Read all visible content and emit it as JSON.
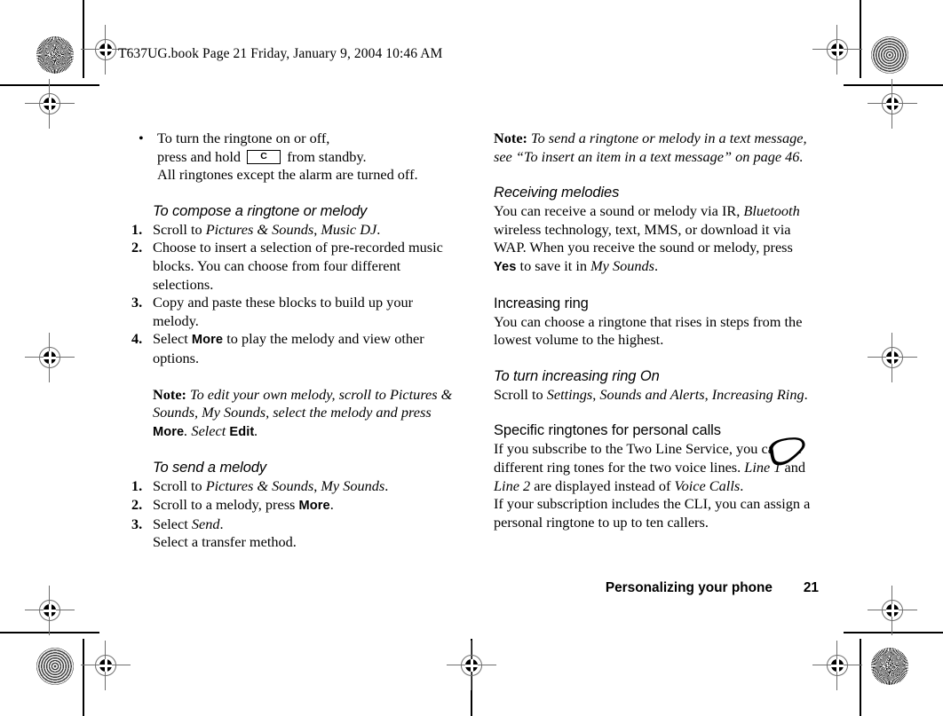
{
  "document": {
    "header_line": "T637UG.book  Page 21  Friday, January 9, 2004  10:46 AM",
    "page_number": "21",
    "footer_title": "Personalizing your phone"
  },
  "left_column": {
    "bullet": {
      "marker": "•",
      "line1": "To turn the ringtone on or off,",
      "line2_before": "press and hold",
      "keycap_label": "C",
      "line2_after": "from standby.",
      "line3": "All ringtones except the alarm are turned off."
    },
    "compose_section": {
      "heading": "To compose a ringtone or melody",
      "steps": [
        {
          "num": "1.",
          "parts": [
            {
              "text": "Scroll to ",
              "style": "plain"
            },
            {
              "text": "Pictures & Sounds",
              "style": "italic"
            },
            {
              "text": ", ",
              "style": "plain"
            },
            {
              "text": "Music DJ",
              "style": "italic"
            },
            {
              "text": ".",
              "style": "plain"
            }
          ]
        },
        {
          "num": "2.",
          "parts": [
            {
              "text": "Choose to insert a selection of pre-recorded music blocks. You can choose from four different selections.",
              "style": "plain"
            }
          ]
        },
        {
          "num": "3.",
          "parts": [
            {
              "text": "Copy and paste these blocks to build up your melody.",
              "style": "plain"
            }
          ]
        },
        {
          "num": "4.",
          "parts": [
            {
              "text": "Select ",
              "style": "plain"
            },
            {
              "text": "More",
              "style": "ui"
            },
            {
              "text": " to play the melody and view other options.",
              "style": "plain"
            }
          ]
        }
      ]
    },
    "note": {
      "label": "Note:",
      "parts": [
        {
          "text": " To edit your own melody, scroll to Pictures & Sounds, My Sounds, select the melody and press ",
          "style": "italic"
        },
        {
          "text": "More",
          "style": "ui"
        },
        {
          "text": ". Select ",
          "style": "italic"
        },
        {
          "text": "Edit",
          "style": "ui"
        },
        {
          "text": ".",
          "style": "italic"
        }
      ]
    },
    "send_section": {
      "heading": "To send a melody",
      "steps": [
        {
          "num": "1.",
          "parts": [
            {
              "text": "Scroll to ",
              "style": "plain"
            },
            {
              "text": "Pictures & Sounds",
              "style": "italic"
            },
            {
              "text": ", ",
              "style": "plain"
            },
            {
              "text": "My Sounds",
              "style": "italic"
            },
            {
              "text": ".",
              "style": "plain"
            }
          ]
        },
        {
          "num": "2.",
          "parts": [
            {
              "text": "Scroll to a melody, press ",
              "style": "plain"
            },
            {
              "text": "More",
              "style": "ui"
            },
            {
              "text": ".",
              "style": "plain"
            }
          ]
        },
        {
          "num": "3.",
          "parts": [
            {
              "text": "Select ",
              "style": "plain"
            },
            {
              "text": "Send",
              "style": "italic"
            },
            {
              "text": ".",
              "style": "plain"
            },
            {
              "text": "\nSelect a transfer method.",
              "style": "plain"
            }
          ]
        }
      ]
    }
  },
  "right_column": {
    "note": {
      "label": "Note:",
      "parts": [
        {
          "text": " To send a ringtone or melody in a text message, see “To insert an item in a text message” on page 46.",
          "style": "italic"
        }
      ]
    },
    "receiving": {
      "heading": "Receiving melodies",
      "parts": [
        {
          "text": "You can receive a sound or melody via IR, ",
          "style": "plain"
        },
        {
          "text": "Bluetooth",
          "style": "italic"
        },
        {
          "text": " wireless technology, text, MMS, or download it via WAP. When you receive the sound or melody, press ",
          "style": "plain"
        },
        {
          "text": "Yes",
          "style": "ui"
        },
        {
          "text": " to save it in ",
          "style": "plain"
        },
        {
          "text": "My Sounds",
          "style": "italic"
        },
        {
          "text": ".",
          "style": "plain"
        }
      ]
    },
    "increasing_ring": {
      "heading": "Increasing ring",
      "parts": [
        {
          "text": "You can choose a ringtone that rises in steps from the lowest volume to the highest.",
          "style": "plain"
        }
      ]
    },
    "increasing_ring_on": {
      "heading": "To turn increasing ring On",
      "parts": [
        {
          "text": "Scroll to ",
          "style": "plain"
        },
        {
          "text": "Settings",
          "style": "italic"
        },
        {
          "text": ", ",
          "style": "plain"
        },
        {
          "text": "Sounds and Alerts",
          "style": "italic"
        },
        {
          "text": ", ",
          "style": "plain"
        },
        {
          "text": "Increasing Ring",
          "style": "italic"
        },
        {
          "text": ".",
          "style": "plain"
        }
      ]
    },
    "specific_ringtones": {
      "heading": "Specific ringtones for personal calls",
      "icon": "sim-card-icon",
      "parts": [
        {
          "text": "If you subscribe to the Two Line Service, you can set different ring tones for the two voice lines. ",
          "style": "plain"
        },
        {
          "text": "Line 1",
          "style": "italic"
        },
        {
          "text": " and ",
          "style": "plain"
        },
        {
          "text": "Line 2",
          "style": "italic"
        },
        {
          "text": " are displayed instead of ",
          "style": "plain"
        },
        {
          "text": "Voice Calls",
          "style": "italic"
        },
        {
          "text": ".",
          "style": "plain"
        },
        {
          "text": "\nIf your subscription includes the CLI, you can assign a personal ringtone to up to ten callers.",
          "style": "plain"
        }
      ]
    }
  },
  "print_marks": {
    "registration_targets": 8,
    "rosettes": 4,
    "ink_color": "#000000"
  }
}
